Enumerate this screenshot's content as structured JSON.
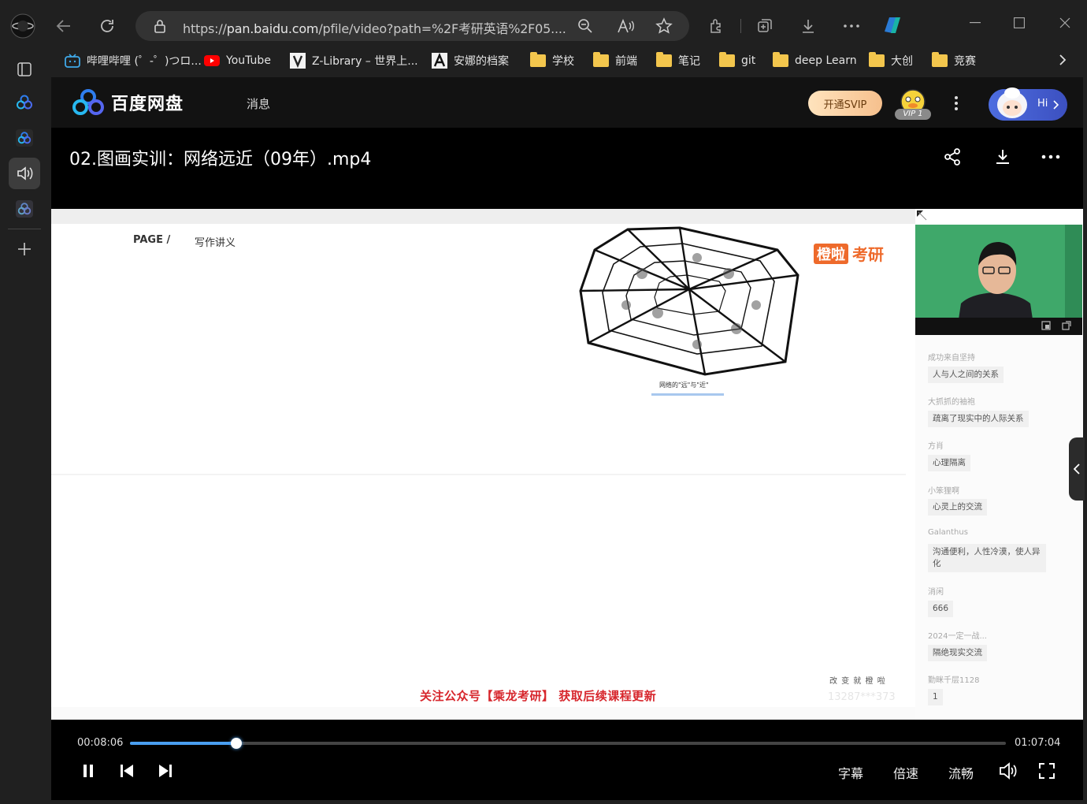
{
  "browser": {
    "url_prefix": "https://",
    "url_host": "pan.baidu.com",
    "url_rest": "/pfile/video?path=%2F考研英语%2F05....",
    "bookmarks": [
      {
        "label": "哔哩哔哩 (゜-゜)つロ...",
        "icon": "bilibili-icon"
      },
      {
        "label": "YouTube",
        "icon": "youtube-icon"
      },
      {
        "label": "Z-Library – 世界上...",
        "icon": "zlibrary-icon"
      },
      {
        "label": "安娜的档案",
        "icon": "annas-archive-icon"
      },
      {
        "label": "学校",
        "icon": "folder-icon"
      },
      {
        "label": "前端",
        "icon": "folder-icon"
      },
      {
        "label": "笔记",
        "icon": "folder-icon"
      },
      {
        "label": "git",
        "icon": "folder-icon"
      },
      {
        "label": "deep Learn",
        "icon": "folder-icon"
      },
      {
        "label": "大创",
        "icon": "folder-icon"
      },
      {
        "label": "竞赛",
        "icon": "folder-icon"
      }
    ]
  },
  "app": {
    "logo_text": "百度网盘",
    "nav_messages": "消息",
    "svip_button": "开通SVIP",
    "vip_badge": "VIP 1",
    "hi_button": "Hi"
  },
  "video": {
    "title": "02.图画实训：网络远近（09年）.mp4",
    "slide": {
      "page_label": "PAGE /",
      "section_label": "写作讲义",
      "caption": "网络的\"远\"与\"近\"",
      "brand_orange": "橙啦",
      "brand_text": "考研",
      "footer_notice": "关注公众号【乘龙考研】 获取后续课程更新",
      "footer_slogan": "改 变 就 橙 啦",
      "watermark": "13287***373"
    },
    "chat": [
      {
        "user": "成功来自坚持",
        "msg": "人与人之间的关系"
      },
      {
        "user": "大抓抓的袖袍",
        "msg": "疏离了现实中的人际关系"
      },
      {
        "user": "方肖",
        "msg": "心理隔离"
      },
      {
        "user": "小笨狸啊",
        "msg": "心灵上的交流"
      },
      {
        "user": "Galanthus",
        "msg": "沟通便利，人性冷漠，使人异化"
      },
      {
        "user": "消闲",
        "msg": "666"
      },
      {
        "user": "2024一定一战...",
        "msg": "隔绝现实交流"
      },
      {
        "user": "勤眯千层1128",
        "msg": "1"
      }
    ]
  },
  "player": {
    "current_time": "00:08:06",
    "total_time": "01:07:04",
    "progress": 0.121,
    "subtitle_button": "字幕",
    "speed_button": "倍速",
    "quality_button": "流畅"
  },
  "colors": {
    "accent": "#4a9ff0",
    "notice_red": "#d7262c",
    "brand_orange": "#ee6a2b"
  }
}
